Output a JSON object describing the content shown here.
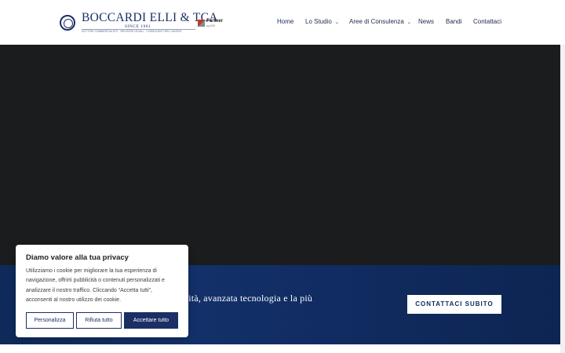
{
  "header": {
    "logo": {
      "name": "BOCCARDI ELLI & TCA",
      "since": "SINCE 1961",
      "tagline": "DOTTORI COMMERCIALISTI · REVISORI LEGALI · CONSULENTI DEL LAVORO",
      "partner_label": "Partner",
      "partner_sub": "ag365"
    },
    "nav": [
      {
        "label": "Home"
      },
      {
        "label": "Lo Studio"
      },
      {
        "label": "Aree di Consulenza"
      },
      {
        "label": "News"
      },
      {
        "label": "Bandi"
      },
      {
        "label": "Contattaci"
      }
    ],
    "chevron": "⌄"
  },
  "banner": {
    "text": "essionalità, avanzata tecnologia e la più",
    "cta": "CONTATTACI SUBITO"
  },
  "cookie": {
    "title": "Diamo valore alla tua privacy",
    "body": "Utilizziamo i cookie per migliorare la tua esperienza di navigazione, offrirti pubblicità o contenuti personalizzati e analizzare il nostro traffico. Cliccando “Accetta tutti”, acconsenti al nostro utilizzo dei cookie.",
    "buttons": {
      "customize": "Personalizza",
      "reject": "Rifiuta tutto",
      "accept": "Accettare tutto"
    }
  },
  "colors": {
    "brand_navy": "#1b2f66",
    "hero_dark": "#1b1c1e",
    "banner_blue": "#13306a"
  }
}
